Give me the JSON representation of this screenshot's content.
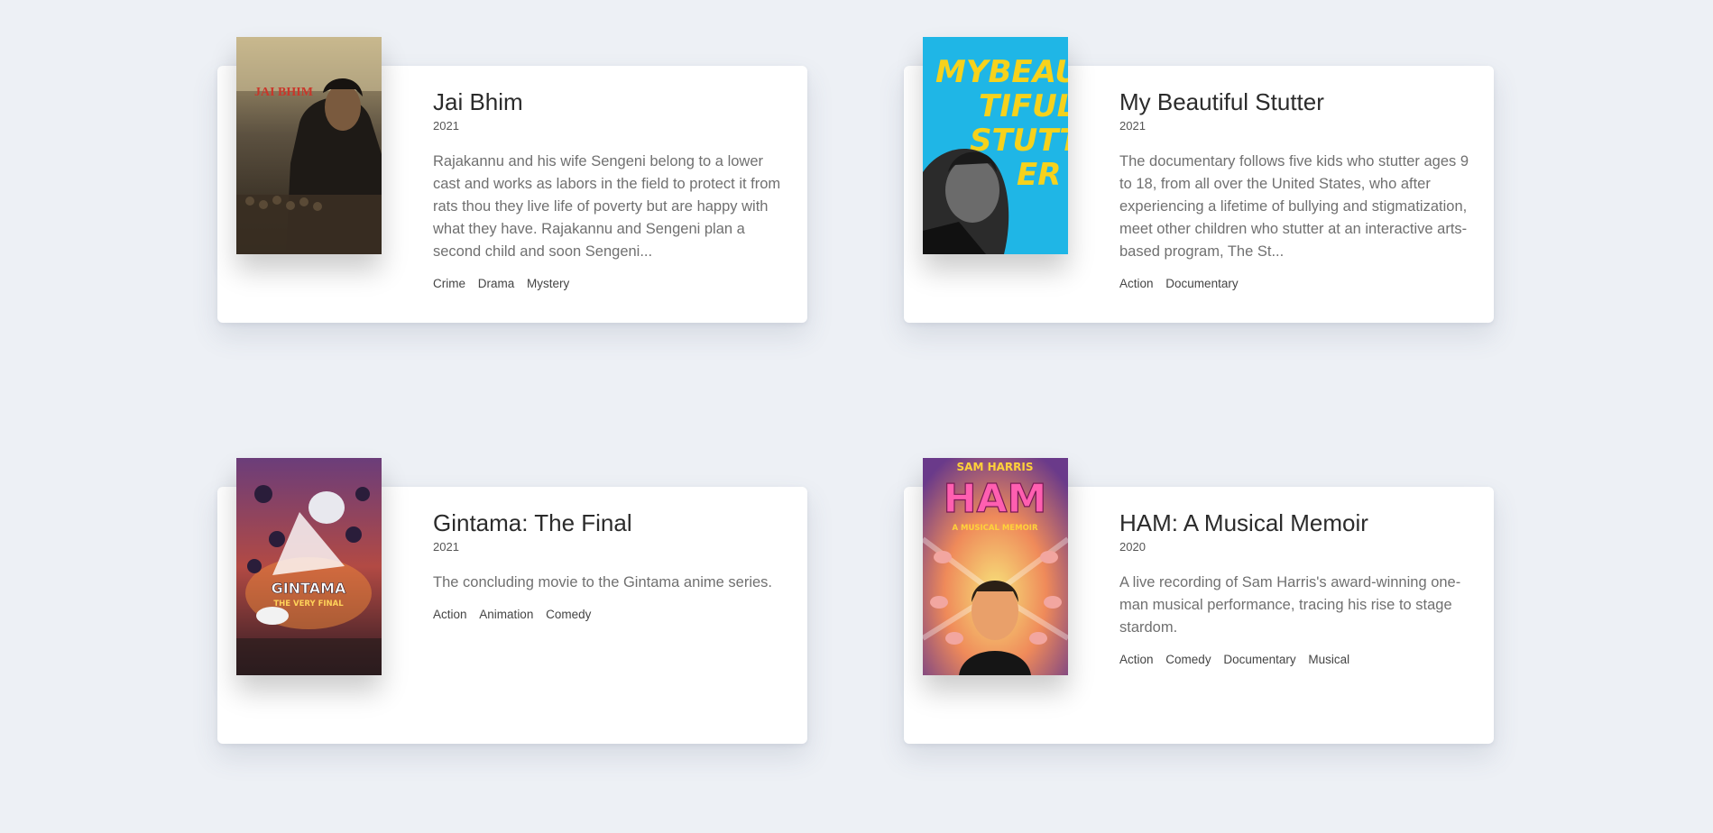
{
  "movies": [
    {
      "title": "Jai Bhim",
      "year": "2021",
      "description": "Rajakannu and his wife Sengeni belong to a lower cast and works as labors in the field to protect it from rats thou they live life of poverty but are happy with what they have. Rajakannu and Sengeni plan a second child and soon Sengeni...",
      "genres": [
        "Crime",
        "Drama",
        "Mystery"
      ],
      "poster_text": "JAI BHIM"
    },
    {
      "title": "My Beautiful Stutter",
      "year": "2021",
      "description": "The documentary follows five kids who stutter ages 9 to 18, from all over the United States, who after experiencing a lifetime of bullying and stigmatization, meet other children who stutter at an interactive arts-based program, The St...",
      "genres": [
        "Action",
        "Documentary"
      ],
      "poster_text": [
        "MYBEAU",
        "TIFUL",
        "STUTT",
        "ER"
      ]
    },
    {
      "title": "Gintama: The Final",
      "year": "2021",
      "description": "The concluding movie to the Gintama anime series.",
      "genres": [
        "Action",
        "Animation",
        "Comedy"
      ],
      "poster_text": [
        "GINTAMA",
        "THE VERY FINAL"
      ]
    },
    {
      "title": "HAM: A Musical Memoir",
      "year": "2020",
      "description": "A live recording of Sam Harris's award-winning one-man musical performance, tracing his rise to stage stardom.",
      "genres": [
        "Action",
        "Comedy",
        "Documentary",
        "Musical"
      ],
      "poster_text": [
        "SAM HARRIS",
        "HAM",
        "A MUSICAL MEMOIR"
      ]
    }
  ],
  "colors": {
    "page_background": "#edf0f5",
    "card_background": "#ffffff"
  }
}
